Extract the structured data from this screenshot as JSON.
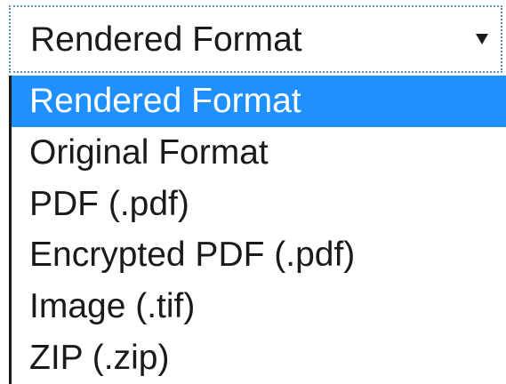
{
  "select": {
    "value": "Rendered Format",
    "arrow_icon": "triangle-down-icon"
  },
  "options": [
    {
      "label": "Rendered Format",
      "selected": true
    },
    {
      "label": "Original Format",
      "selected": false
    },
    {
      "label": "PDF (.pdf)",
      "selected": false
    },
    {
      "label": "Encrypted PDF (.pdf)",
      "selected": false
    },
    {
      "label": "Image (.tif)",
      "selected": false
    },
    {
      "label": "ZIP (.zip)",
      "selected": false
    }
  ],
  "colors": {
    "highlight": "#1e90ff",
    "highlight_text": "#ffffff",
    "text": "#1a1a1a",
    "focus_border": "#5b8fbf"
  }
}
